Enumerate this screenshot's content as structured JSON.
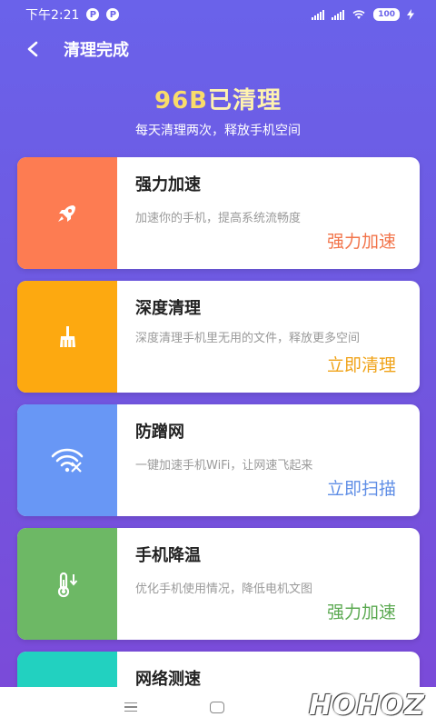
{
  "status": {
    "time": "下午2:21",
    "badge_1": "P",
    "badge_2": "P",
    "battery": "100"
  },
  "header": {
    "title": "清理完成"
  },
  "hero": {
    "amount": "96B",
    "amount_suffix": "已清理",
    "subtitle": "每天清理两次，释放手机空间"
  },
  "cards": [
    {
      "title": "强力加速",
      "desc": "加速你的手机，提高系统流畅度",
      "action": "强力加速",
      "panel_color": "#fd7c52",
      "action_color": "#f2744a",
      "icon": "rocket-icon"
    },
    {
      "title": "深度清理",
      "desc": "深度清理手机里无用的文件，释放更多空间",
      "action": "立即清理",
      "panel_color": "#fda910",
      "action_color": "#f0a319",
      "icon": "broom-icon"
    },
    {
      "title": "防蹭网",
      "desc": "一键加速手机WiFi，让网速飞起来",
      "action": "立即扫描",
      "panel_color": "#6897f5",
      "action_color": "#5f8ee6",
      "icon": "wifi-shield-icon"
    },
    {
      "title": "手机降温",
      "desc": "优化手机使用情况，降低电机文图",
      "action": "强力加速",
      "panel_color": "#6db865",
      "action_color": "#5caa52",
      "icon": "thermometer-icon"
    },
    {
      "title": "网络测速",
      "desc": "",
      "action": "",
      "panel_color": "#22d1c0",
      "action_color": "#22d1c0",
      "icon": "speed-icon"
    }
  ],
  "watermark": "ᕼOᕼOZ"
}
